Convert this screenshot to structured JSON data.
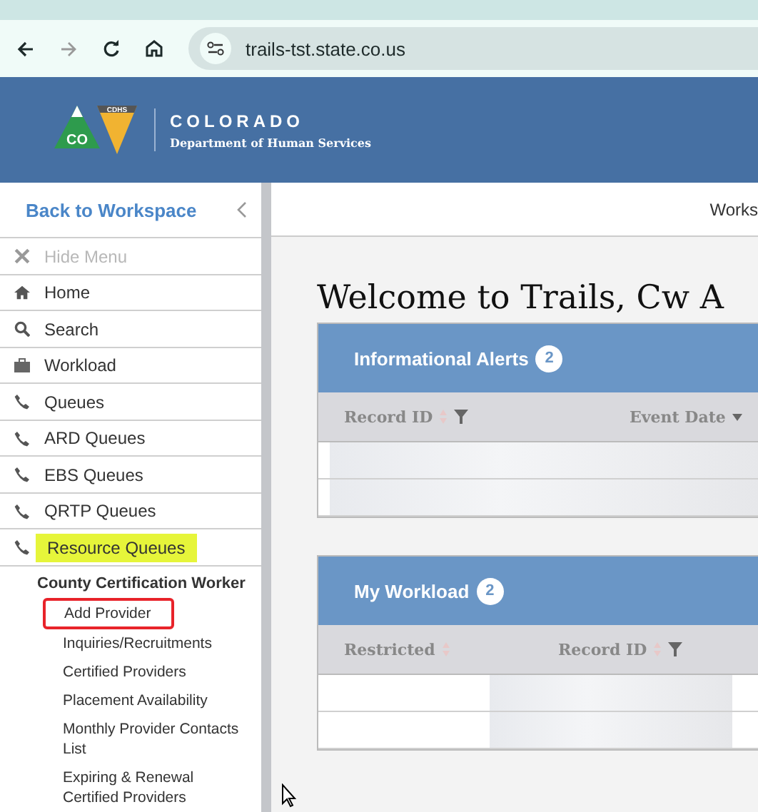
{
  "browser": {
    "url": "trails-tst.state.co.us"
  },
  "header": {
    "logo_badge": "CO",
    "logo_tag": "CDHS",
    "agency": "COLORADO",
    "department": "Department of Human Services"
  },
  "sidebar": {
    "back_link": "Back to Workspace",
    "items": [
      {
        "label": "Hide Menu",
        "kind": "close",
        "disabled": true,
        "highlighted": false
      },
      {
        "label": "Home",
        "kind": "home",
        "disabled": false,
        "highlighted": false
      },
      {
        "label": "Search",
        "kind": "search",
        "disabled": false,
        "highlighted": false
      },
      {
        "label": "Workload",
        "kind": "briefcase",
        "disabled": false,
        "highlighted": false
      },
      {
        "label": "Queues",
        "kind": "phone",
        "disabled": false,
        "highlighted": false
      },
      {
        "label": "ARD Queues",
        "kind": "phone",
        "disabled": false,
        "highlighted": false
      },
      {
        "label": "EBS Queues",
        "kind": "phone",
        "disabled": false,
        "highlighted": false
      },
      {
        "label": "QRTP Queues",
        "kind": "phone",
        "disabled": false,
        "highlighted": false
      },
      {
        "label": "Resource Queues",
        "kind": "phone",
        "disabled": false,
        "highlighted": true
      }
    ],
    "section": {
      "title": "County Certification Worker",
      "links": [
        {
          "label": "Add Provider",
          "circled": true
        },
        {
          "label": "Inquiries/Recruitments",
          "circled": false
        },
        {
          "label": "Certified Providers",
          "circled": false
        },
        {
          "label": "Placement Availability",
          "circled": false
        },
        {
          "label": "Monthly Provider Contacts List",
          "circled": false
        },
        {
          "label": "Expiring & Renewal Certified Providers",
          "circled": false
        }
      ]
    }
  },
  "top_bar": {
    "link": "Works"
  },
  "main": {
    "heading": "Welcome to Trails, Cw A",
    "panels": [
      {
        "kind": "alerts",
        "title": "Informational Alerts",
        "count": "2",
        "columns": [
          {
            "label": "Record ID",
            "sorted": false,
            "filter": true
          },
          {
            "label": "Event Date",
            "sorted": true,
            "filter": false
          }
        ],
        "rows": [
          {
            "redacted": true
          },
          {
            "redacted": true
          }
        ]
      },
      {
        "kind": "workload",
        "title": "My Workload",
        "count": "2",
        "columns": [
          {
            "label": "Restricted",
            "sorted": false,
            "filter": false
          },
          {
            "label": "Record ID",
            "sorted": false,
            "filter": true
          }
        ],
        "rows": [
          {
            "redacted": true
          },
          {
            "redacted": true
          }
        ]
      }
    ]
  }
}
